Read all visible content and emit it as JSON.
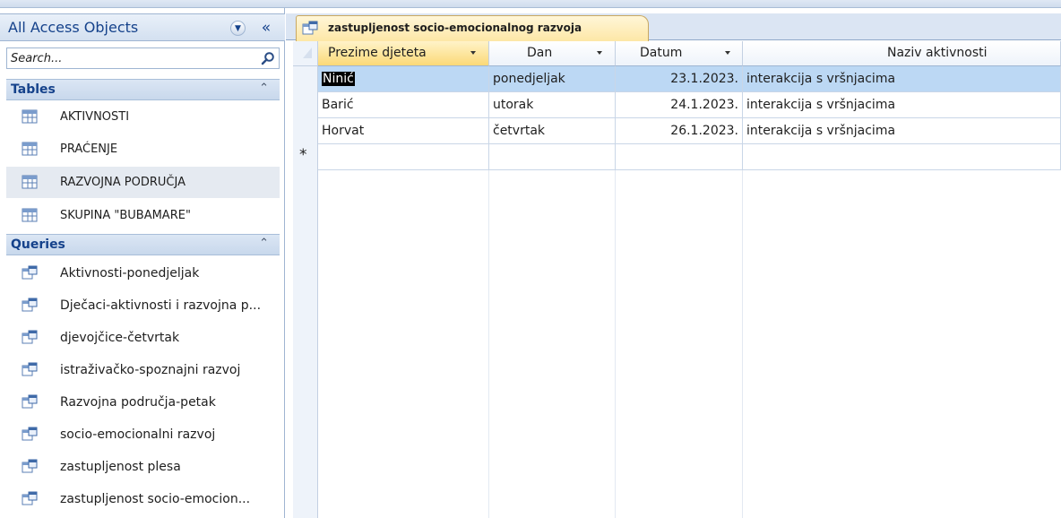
{
  "nav": {
    "title": "All Access Objects",
    "search_placeholder": "Search...",
    "groups": [
      {
        "label": "Tables",
        "items": [
          {
            "label": "AKTIVNOSTI"
          },
          {
            "label": "PRAĆENJE"
          },
          {
            "label": "RAZVOJNA PODRUČJA"
          },
          {
            "label": "SKUPINA \"BUBAMARE\""
          }
        ]
      },
      {
        "label": "Queries",
        "items": [
          {
            "label": "Aktivnosti-ponedjeljak"
          },
          {
            "label": "Dječaci-aktivnosti i razvojna p..."
          },
          {
            "label": "djevojčice-četvrtak"
          },
          {
            "label": "istraživačko-spoznajni razvoj"
          },
          {
            "label": "Razvojna područja-petak"
          },
          {
            "label": "socio-emocionalni razvoj"
          },
          {
            "label": "zastupljenost plesa"
          },
          {
            "label": "zastupljenost socio-emocion..."
          }
        ]
      }
    ]
  },
  "document": {
    "tab_label": "zastupljenost socio-emocionalnog razvoja",
    "columns": [
      {
        "label": "Prezime djeteta"
      },
      {
        "label": "Dan"
      },
      {
        "label": "Datum"
      },
      {
        "label": "Naziv aktivnosti"
      }
    ],
    "rows": [
      {
        "prezime": "Ninić",
        "dan": "ponedjeljak",
        "datum": "23.1.2023.",
        "aktivnost": "interakcija s vršnjacima"
      },
      {
        "prezime": "Barić",
        "dan": "utorak",
        "datum": "24.1.2023.",
        "aktivnost": "interakcija s vršnjacima"
      },
      {
        "prezime": "Horvat",
        "dan": "četvrtak",
        "datum": "26.1.2023.",
        "aktivnost": "interakcija s vršnjacima"
      }
    ],
    "new_row_marker": "*"
  },
  "colors": {
    "accent": "#15428b",
    "selected_row": "#bcd8f4",
    "active_tab": "#fde7a6"
  }
}
